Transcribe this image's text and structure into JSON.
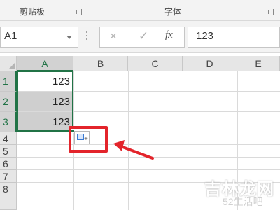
{
  "ribbon": {
    "clipboard_label": "剪贴板",
    "font_label": "字体"
  },
  "formula_bar": {
    "name_box": "A1",
    "cancel_icon": "×",
    "enter_icon": "✓",
    "fx_label": "fx",
    "value": "123"
  },
  "grid": {
    "columns": [
      "A",
      "B",
      "C",
      "D",
      "E"
    ],
    "rows": [
      "1",
      "2",
      "3",
      "4",
      "5",
      "6",
      "7",
      "8"
    ],
    "cells": {
      "A1": "123",
      "A2": "123",
      "A3": "123"
    },
    "selected_range": "A1:A3"
  },
  "quick_analysis_button": {
    "icon": "paste-options-icon",
    "highlight_color": "#e3242b"
  },
  "watermark": {
    "line1": "吉林龙网",
    "line2": "52生活吧"
  },
  "colors": {
    "accent": "#217346",
    "annotation": "#e3242b"
  }
}
